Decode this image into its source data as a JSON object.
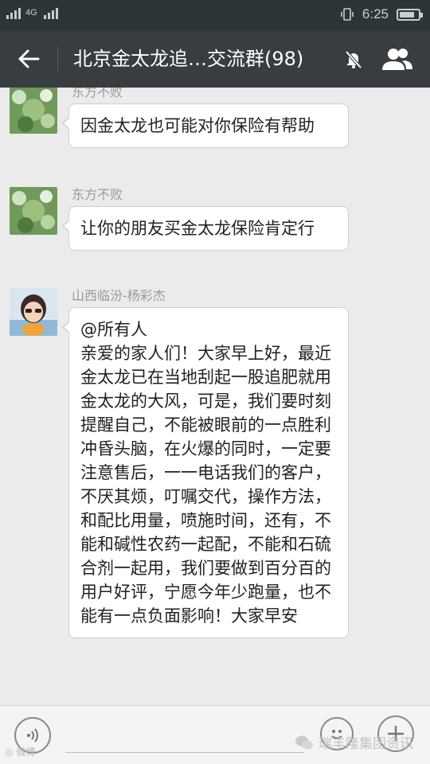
{
  "status_bar": {
    "network_1": "4G",
    "time": "6:25",
    "battery_level": 0.8
  },
  "header": {
    "title": "北京金太龙追…交流群(98)",
    "back_icon": "arrow-left-icon",
    "mute_icon": "bell-off-icon",
    "members_icon": "group-members-icon"
  },
  "messages": [
    {
      "sender": "东方不败",
      "text": "因金太龙也可能对你保险有帮助"
    },
    {
      "sender": "东方不败",
      "text": "让你的朋友买金太龙保险肯定行"
    },
    {
      "sender": "山西临汾-杨彩杰",
      "text": "@所有人\n亲爱的家人们！大家早上好，最近金太龙已在当地刮起一股追肥就用金太龙的大风，可是，我们要时刻提醒自己，不能被眼前的一点胜利冲昏头脑，在火爆的同时，一定要注意售后，一一电话我们的客户，不厌其烦，叮嘱交代，操作方法，和配比用量，喷施时间，还有，不能和碱性农药一起配，不能和石硫合剂一起用，我们要做到百分百的用户好评，宁愿今年少跑量，也不能有一点负面影响！大家早安"
    }
  ],
  "input_bar": {
    "voice_icon": "voice-icon",
    "emoji_icon": "emoji-icon",
    "plus_icon": "plus-icon"
  },
  "watermarks": {
    "left": "微博",
    "right": "瑞丰隆集团资讯"
  }
}
